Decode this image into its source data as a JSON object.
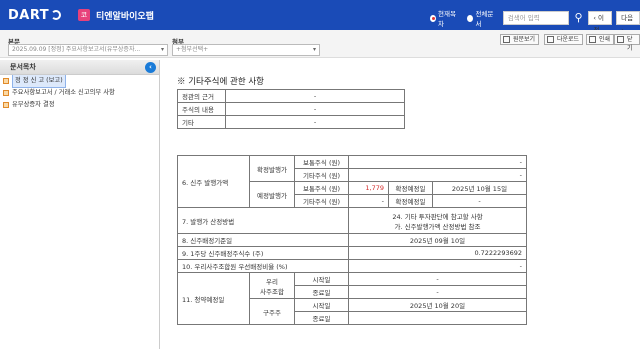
{
  "header": {
    "logo": "DART",
    "corp_badge": "코",
    "corp_name": "티엔알바이오팹",
    "scope_options": [
      "현재목차",
      "전체문서"
    ],
    "search_placeholder": "검색어 입력",
    "prev_label": "이전",
    "next_label": "다음"
  },
  "subheader": {
    "report_label": "본문",
    "report_value": "2025.09.09 [정정] 주요사항보고서(유무상증자...",
    "attach_label": "첨부",
    "attach_value": "+첨부선택+",
    "tools": [
      "원문보기",
      "다운로드",
      "인쇄",
      "닫기"
    ]
  },
  "sidebar": {
    "title": "문서목차",
    "items": [
      {
        "label": "정 정 신 고 (보고)",
        "active": true
      },
      {
        "label": "주요사항보고서 / 거래소 신고의무 사항",
        "active": false
      },
      {
        "label": "유무상증자 결정",
        "active": false
      }
    ]
  },
  "document": {
    "section_title": "※ 기타주식에 관한 사항",
    "other_stock_table": [
      {
        "label": "정관의 근거",
        "value": "-"
      },
      {
        "label": "주식의 내용",
        "value": "-"
      },
      {
        "label": "기타",
        "value": "-"
      }
    ],
    "main_table": {
      "r6_label": "6. 신주 발행가액",
      "confirmed": "확정발행가",
      "expected": "예정발행가",
      "common_won": "보통주식 (원)",
      "other_won": "기타주식 (원)",
      "dash": "-",
      "common_expected_value": "1,779",
      "confirm_date_label": "확정예정일",
      "confirm_date_value": "2025년 10월 15일",
      "r7_label": "7. 발행가 산정방법",
      "r7_value_1": "24. 기타 투자판단에 참고할 사항",
      "r7_value_2": "가. 신주발행가액 산정방법 참조",
      "r8_label": "8. 신주배정기준일",
      "r8_value": "2025년 09월 10일",
      "r9_label": "9. 1주당 신주배정주식수 (주)",
      "r9_value": "0.7222293692",
      "r10_label": "10. 우리사주조합원 우선배정비율 (%)",
      "r10_value": "-",
      "r11_label": "11. 청약예정일",
      "esop_label_1": "우리",
      "esop_label_2": "사주조합",
      "start_label": "시작일",
      "end_label": "종료일",
      "esop_start": "-",
      "esop_end": "-",
      "shareholder_label": "구주주",
      "shareholder_start": "2025년 10월 20일"
    }
  }
}
